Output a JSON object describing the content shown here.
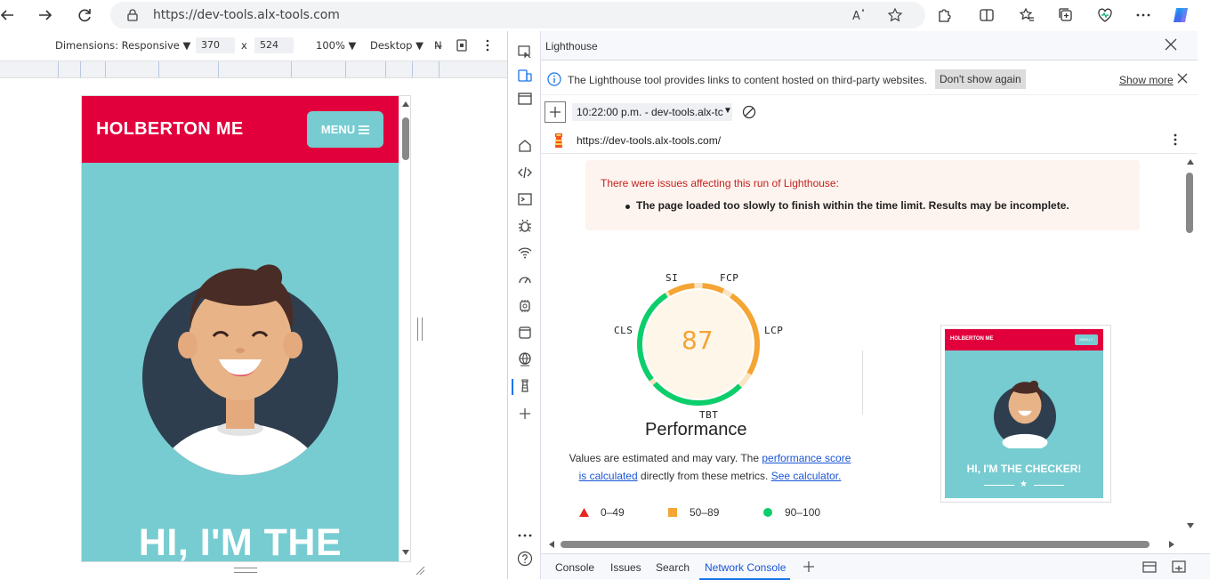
{
  "browser": {
    "url": "https://dev-tools.alx-tools.com"
  },
  "device_toolbar": {
    "dimensions_label": "Dimensions: Responsive",
    "width": "370",
    "times": "x",
    "height": "524",
    "zoom": "100%",
    "mode": "Desktop",
    "no_throttle": "N̶"
  },
  "page": {
    "brand": "HOLBERTON ME",
    "menu_label": "MENU",
    "hero_text": "HI, I'M THE"
  },
  "devtools": {
    "panel_title": "Lighthouse",
    "info_message": "The Lighthouse tool provides links to content hosted on third-party websites.",
    "dont_show_again": "Don't show again",
    "show_more": "Show more",
    "report_time": "10:22:00 p.m. - dev-tools.alx-tc",
    "report_url": "https://dev-tools.alx-tools.com/",
    "warning_title": "There were issues affecting this run of Lighthouse:",
    "warning_item": "The page loaded too slowly to finish within the time limit. Results may be incomplete.",
    "score": "87",
    "gauge_labels": {
      "si": "SI",
      "fcp": "FCP",
      "lcp": "LCP",
      "tbt": "TBT",
      "cls": "CLS"
    },
    "category": "Performance",
    "note_prefix": "Values are estimated and may vary. The ",
    "note_link1": "performance score",
    "note_link2": "is calculated",
    "note_mid": " directly from these metrics. ",
    "note_link3": "See calculator.",
    "legend": [
      {
        "range": "0–49",
        "color": "#e8251f"
      },
      {
        "range": "50–89",
        "color": "#f4a534"
      },
      {
        "range": "90–100",
        "color": "#0cce6b"
      }
    ],
    "screenshot_brand": "HOLBERTON ME",
    "screenshot_menu": "MENU ≡",
    "screenshot_hero": "HI, I'M THE CHECKER!",
    "bottom_tabs": [
      "Console",
      "Issues",
      "Search",
      "Network Console"
    ]
  },
  "colors": {
    "brand_red": "#e1003c",
    "teal": "#77ccd1",
    "score_orange": "#f4a534",
    "score_green": "#0cce6b"
  }
}
